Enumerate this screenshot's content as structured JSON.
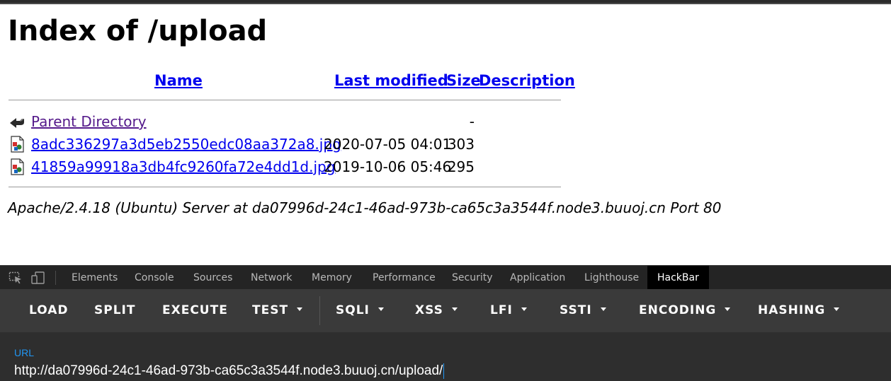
{
  "listing": {
    "title": "Index of /upload",
    "columns": {
      "name": "Name",
      "last_modified": "Last modified",
      "size": "Size",
      "description": "Description"
    },
    "rows": [
      {
        "icon": "back-arrow-icon",
        "name": "Parent Directory",
        "last_modified": "",
        "size": "-",
        "visited": true
      },
      {
        "icon": "image-file-icon",
        "name": "8adc336297a3d5eb2550edc08aa372a8.jpg",
        "last_modified": "2020-07-05 04:01",
        "size": "303",
        "visited": false
      },
      {
        "icon": "image-file-icon",
        "name": "41859a99918a3db4fc9260fa72e4dd1d.jpg",
        "last_modified": "2019-10-06 05:46",
        "size": "295",
        "visited": false
      }
    ],
    "address": "Apache/2.4.18 (Ubuntu) Server at da07996d-24c1-46ad-973b-ca65c3a3544f.node3.buuoj.cn Port 80"
  },
  "devtools": {
    "tabs": [
      "Elements",
      "Console",
      "Sources",
      "Network",
      "Memory",
      "Performance",
      "Security",
      "Application",
      "Lighthouse",
      "HackBar"
    ],
    "active_tab": "HackBar"
  },
  "hackbar": {
    "buttons": [
      {
        "label": "LOAD",
        "dropdown": false
      },
      {
        "label": "SPLIT",
        "dropdown": false
      },
      {
        "label": "EXECUTE",
        "dropdown": false
      },
      {
        "label": "TEST",
        "dropdown": true
      },
      {
        "label": "SQLI",
        "dropdown": true
      },
      {
        "label": "XSS",
        "dropdown": true
      },
      {
        "label": "LFI",
        "dropdown": true
      },
      {
        "label": "SSTI",
        "dropdown": true
      },
      {
        "label": "ENCODING",
        "dropdown": true
      },
      {
        "label": "HASHING",
        "dropdown": true
      }
    ],
    "url_label": "URL",
    "url_value": "http://da07996d-24c1-46ad-973b-ca65c3a3544f.node3.buuoj.cn/upload/"
  },
  "colors": {
    "link": "#0000ee",
    "visited_link": "#551a8b",
    "hackbar_toolbar": "#3a3a3a",
    "hackbar_body": "#2e2e2e",
    "url_label": "#2196f3"
  }
}
